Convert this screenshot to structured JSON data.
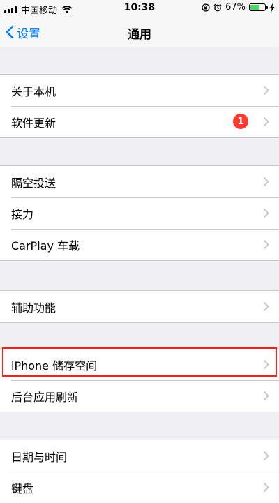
{
  "status_bar": {
    "carrier": "中国移动",
    "time": "10:38",
    "battery_percent": "67%",
    "battery_level": 0.67
  },
  "nav": {
    "back_label": "设置",
    "title": "通用"
  },
  "groups": [
    {
      "items": [
        {
          "label": "关于本机"
        },
        {
          "label": "软件更新",
          "badge": "1"
        }
      ]
    },
    {
      "items": [
        {
          "label": "隔空投送"
        },
        {
          "label": "接力"
        },
        {
          "label": "CarPlay 车载"
        }
      ]
    },
    {
      "items": [
        {
          "label": "辅助功能"
        }
      ]
    },
    {
      "items": [
        {
          "label": "iPhone 储存空间"
        },
        {
          "label": "后台应用刷新"
        }
      ]
    },
    {
      "items": [
        {
          "label": "日期与时间"
        },
        {
          "label": "键盘"
        }
      ]
    }
  ],
  "colors": {
    "accent": "#007aff",
    "badge": "#ff3b30",
    "highlight": "#e8251f",
    "battery": "#4cd964"
  }
}
